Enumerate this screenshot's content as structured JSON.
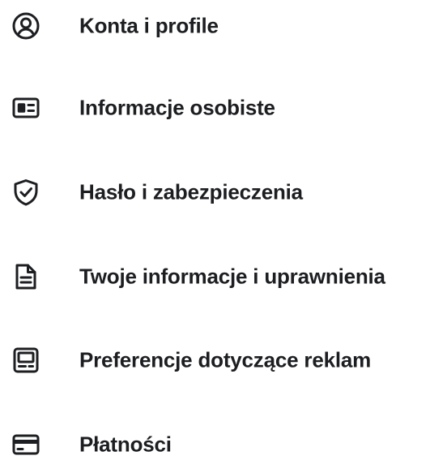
{
  "menu": {
    "items": [
      {
        "icon": "account-circle-icon",
        "label": "Konta i profile"
      },
      {
        "icon": "id-card-icon",
        "label": "Informacje osobiste"
      },
      {
        "icon": "shield-check-icon",
        "label": "Hasło i zabezpieczenia"
      },
      {
        "icon": "document-icon",
        "label": "Twoje informacje i uprawnienia"
      },
      {
        "icon": "ad-display-icon",
        "label": "Preferencje dotyczące reklam"
      },
      {
        "icon": "credit-card-icon",
        "label": "Płatności"
      }
    ]
  },
  "colors": {
    "text": "#1c1e21",
    "icon": "#1c1e21",
    "background": "#ffffff"
  }
}
